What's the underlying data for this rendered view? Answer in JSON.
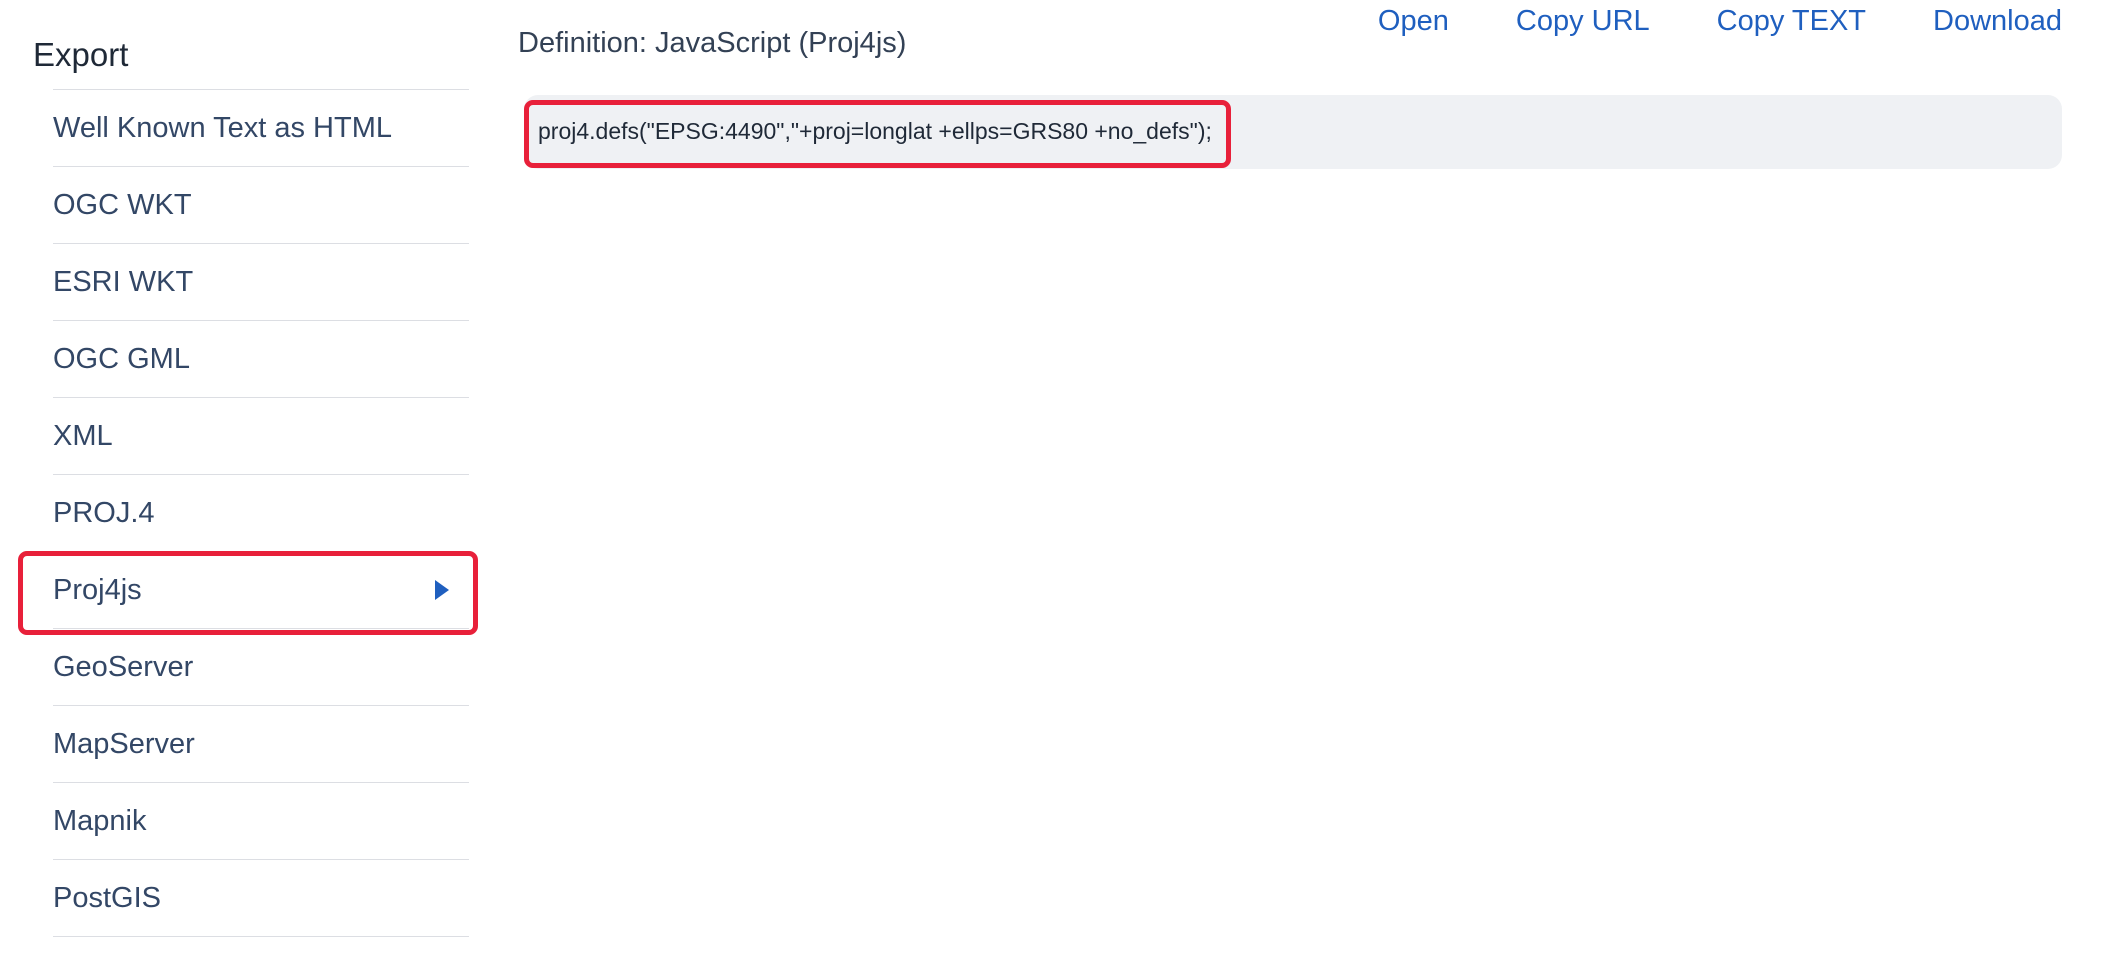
{
  "sidebar": {
    "title": "Export",
    "items": [
      {
        "label": "Well Known Text as HTML"
      },
      {
        "label": "OGC WKT"
      },
      {
        "label": "ESRI WKT"
      },
      {
        "label": "OGC GML"
      },
      {
        "label": "XML"
      },
      {
        "label": "PROJ.4"
      },
      {
        "label": "Proj4js",
        "active": true
      },
      {
        "label": "GeoServer"
      },
      {
        "label": "MapServer"
      },
      {
        "label": "Mapnik"
      },
      {
        "label": "PostGIS"
      }
    ]
  },
  "main": {
    "definition_title": "Definition: JavaScript (Proj4js)",
    "actions": {
      "open": "Open",
      "copy_url": "Copy URL",
      "copy_text": "Copy TEXT",
      "download": "Download"
    },
    "code": "proj4.defs(\"EPSG:4490\",\"+proj=longlat +ellps=GRS80 +no_defs\");"
  },
  "colors": {
    "link": "#1f5fbf",
    "highlight": "#e8203a",
    "code_bg": "#eff1f4"
  }
}
